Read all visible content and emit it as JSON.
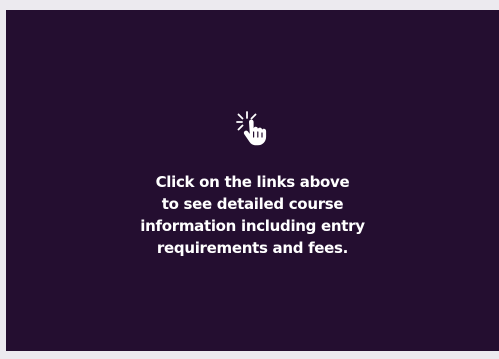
{
  "panel": {
    "icon": "click-hand-icon",
    "background_color": "#240e30",
    "text_color": "#ffffff",
    "message_lines": [
      "Click on the links above",
      "to see detailed course",
      "information including entry",
      "requirements and fees."
    ]
  }
}
